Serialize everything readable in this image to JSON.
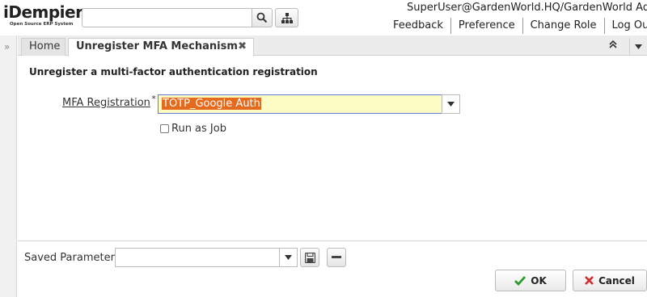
{
  "header": {
    "logo_text": "iDempiere",
    "logo_tagline": "Open Source ERP System",
    "search_placeholder": "",
    "user_info": "SuperUser@GardenWorld.HQ/GardenWorld Admin",
    "links": [
      "Feedback",
      "Preference",
      "Change Role",
      "Log Out"
    ]
  },
  "tabs": {
    "home_label": "Home",
    "active_label": "Unregister MFA Mechanism"
  },
  "process": {
    "description": "Unregister a multi-factor authentication registration",
    "mfa_label": "MFA Registration",
    "mfa_required_mark": "*",
    "mfa_value": "TOTP_Google Auth",
    "run_as_job_label": "Run as Job",
    "run_as_job_checked": false
  },
  "footer": {
    "saved_params_label": "Saved Parameters",
    "saved_params_value": "",
    "ok_label": "OK",
    "cancel_label": "Cancel"
  },
  "colors": {
    "input_focus_bg": "#fcfcc4",
    "selection": "#e46a1e",
    "ok_icon": "#2e9a2e",
    "cancel_icon": "#d32a2a"
  },
  "icons": {
    "search": "search-icon",
    "tree": "tree-icon",
    "close_tab": "close-icon",
    "maximize": "double-chevron-up-icon",
    "expand_west": "double-chevron-right-icon",
    "dropdown": "chevron-down-icon",
    "save": "floppy-disk-icon",
    "delete": "minus-icon",
    "ok": "check-icon",
    "cancel": "x-icon"
  }
}
